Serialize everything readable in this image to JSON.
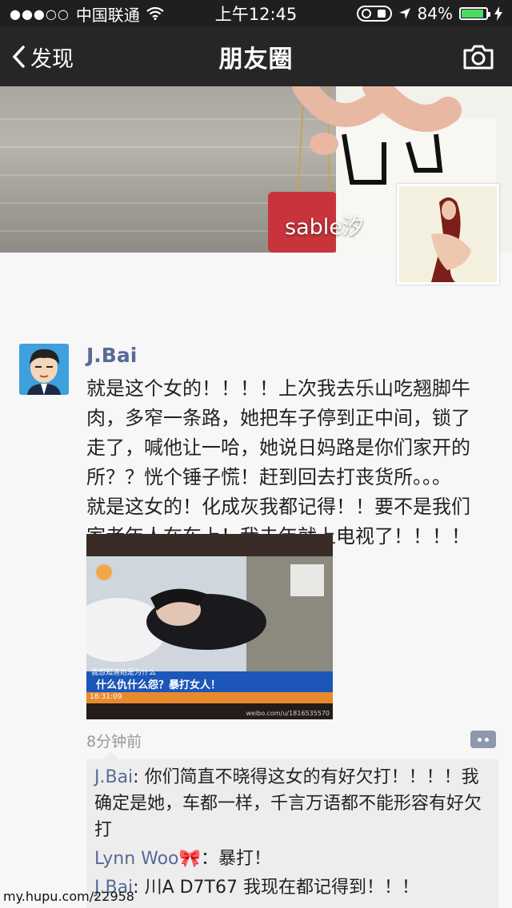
{
  "status_bar": {
    "carrier": "中国联通",
    "time": "上午12:45",
    "battery": "84%",
    "battery_level": 0.84
  },
  "nav": {
    "back_label": "发现",
    "title": "朋友圈"
  },
  "cover": {
    "name": "sable汐"
  },
  "post": {
    "author": "J.Bai",
    "text_lines": [
      "就是这个女的！！！！上次我去乐山吃翘脚牛",
      "肉，多窄一条路，她把车子停到正中间，锁了",
      "走了，喊他让一哈，她说日妈路是你们家开的",
      "所？？恍个锤子慌！赶到回去打丧货所。。。",
      "就是这女的！化成灰我都记得！！要不是我们",
      "家老年人在车上！我去年就上电视了！！！！"
    ],
    "image_caption": "什么仇什么怨？暴打女人！",
    "image_subcaption": "我想知道她是为什么",
    "image_ticker": "18:31:09",
    "image_credit": "weibo.com/u/1816535570",
    "time": "8分钟前"
  },
  "comments": [
    {
      "author": "J.Bai",
      "sep": ": ",
      "text": "你们简直不晓得这女的有好欠打！！！！我确定是她，车都一样，千言万语都不能形容有好欠打"
    },
    {
      "author": "Lynn Woo",
      "emoji": "🎀",
      "sep": "：",
      "text": "暴打！"
    },
    {
      "author": "J.Bai",
      "sep": ": ",
      "text": "川A D7T67 我现在都记得到！！！"
    }
  ],
  "watermark": "my.hupu.com/22958"
}
